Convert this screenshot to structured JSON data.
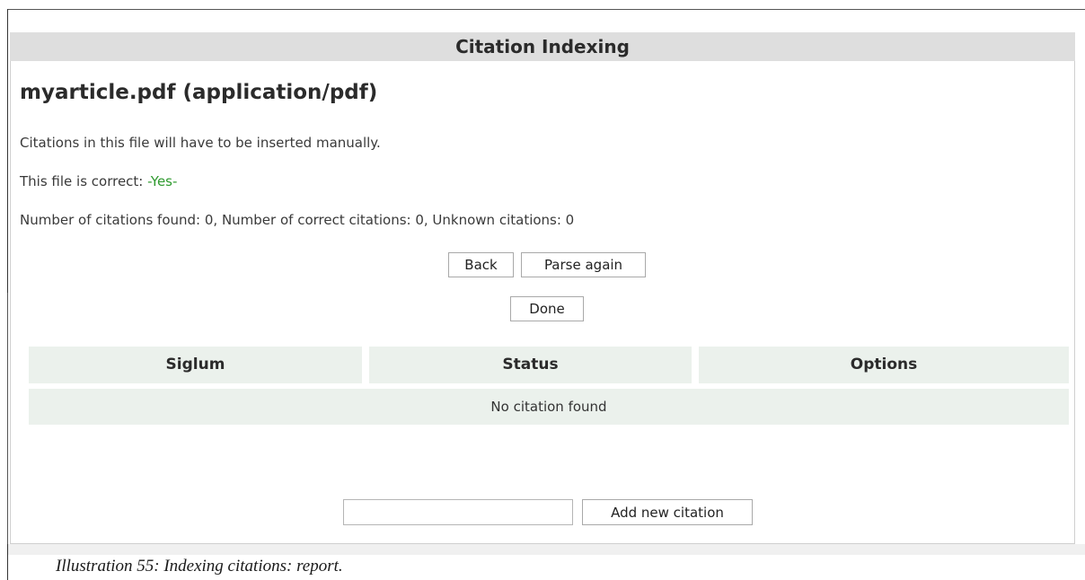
{
  "header": {
    "title": "Citation Indexing"
  },
  "file": {
    "title": "myarticle.pdf (application/pdf)",
    "manual_note": "Citations in this file will have to be inserted manually.",
    "correct_label": "This file is correct: ",
    "correct_value": "-Yes-",
    "counts_text": "Number of citations found: 0, Number of correct citations: 0, Unknown citations: 0"
  },
  "buttons": {
    "back": "Back",
    "parse_again": "Parse again",
    "done": "Done",
    "add_new": "Add new citation"
  },
  "table": {
    "columns": [
      "Siglum",
      "Status",
      "Options"
    ],
    "empty_message": "No citation found"
  },
  "new_citation": {
    "value": "",
    "placeholder": ""
  },
  "caption": "Illustration 55: Indexing citations: report.",
  "colors": {
    "header_bg": "#dedede",
    "table_bg": "#ebf1ec",
    "yes_green": "#2f9a2f"
  }
}
